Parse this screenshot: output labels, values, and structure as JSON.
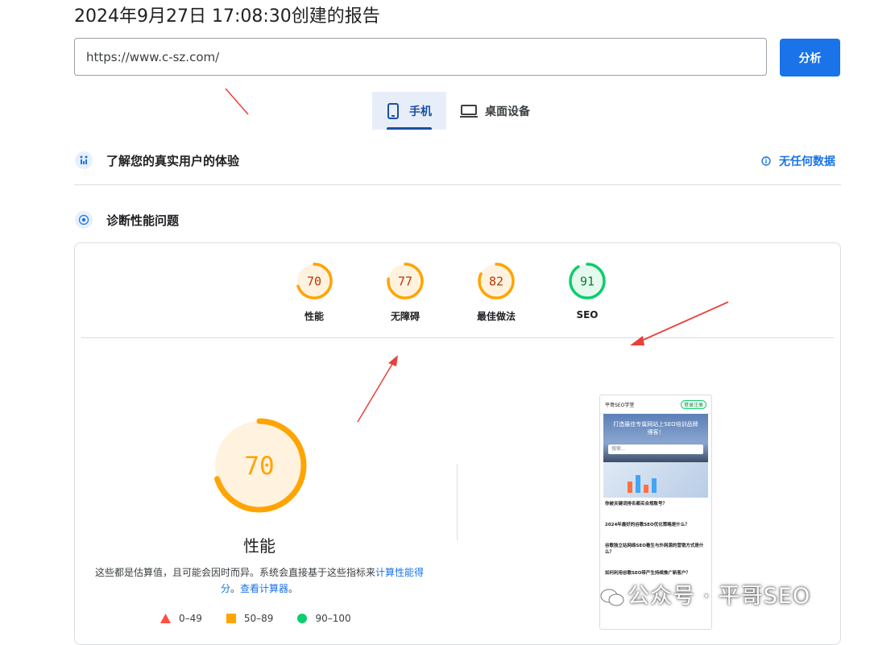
{
  "header": {
    "title": "2024年9月27日 17:08:30创建的报告"
  },
  "url_input": {
    "value": "https://www.c-sz.com/"
  },
  "analyze_button": {
    "label": "分析"
  },
  "tabs": [
    {
      "label": "手机"
    },
    {
      "label": "桌面设备"
    }
  ],
  "crux_section": {
    "title": "了解您的真实用户的体验",
    "no_data_label": "无任何数据"
  },
  "diagnose_section": {
    "title": "诊断性能问题"
  },
  "scores": [
    {
      "label": "性能",
      "value": "70",
      "score": 70,
      "color": "#ffa400"
    },
    {
      "label": "无障碍",
      "value": "77",
      "score": 77,
      "color": "#ffa400"
    },
    {
      "label": "最佳做法",
      "value": "82",
      "score": 82,
      "color": "#ffa400"
    },
    {
      "label": "SEO",
      "value": "91",
      "score": 91,
      "color": "#0cce6b"
    }
  ],
  "main_gauge": {
    "value": "70",
    "score": 70,
    "label": "性能"
  },
  "note": {
    "text": "这些都是估算值，且可能会因时而异。系统会直接基于这些指标来",
    "link1": "计算性能得分",
    "sep": "。",
    "link2": "查看计算器",
    "end": "。"
  },
  "legend": [
    {
      "range": "0–49",
      "color": "#ff4e42"
    },
    {
      "range": "50–89",
      "color": "#ffa400"
    },
    {
      "range": "90–100",
      "color": "#0cce6b"
    }
  ],
  "screenshot": {
    "site_name": "平哥SEO学堂",
    "header_button": "登录注册",
    "banner_text": "打造最佳专属网站上SEO培训品牌博客！",
    "search_placeholder": "搜索...",
    "posts": [
      "你被关键词排名都买合规账号？",
      "2024年最好的谷歌SEO优化策略是什么？",
      "谷歌独立站网络SEO看生与外网源的营销方式是什么？",
      "如何利用谷歌SEO带产生持续推广新客户？"
    ]
  },
  "watermark": {
    "text": "公众号 · 平哥SEO"
  },
  "colors": {
    "accent": "#1a73e8",
    "average": "#ffa400",
    "pass": "#0cce6b",
    "fail": "#ff4e42"
  }
}
